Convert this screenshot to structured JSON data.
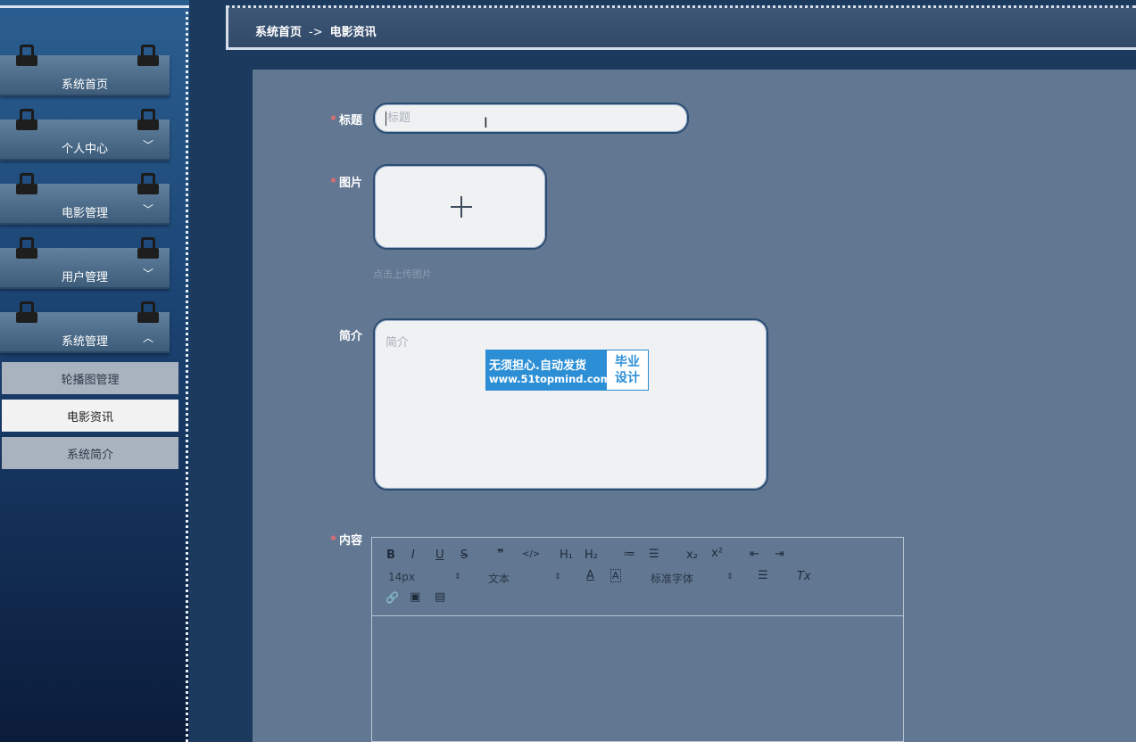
{
  "sidebar": {
    "items": [
      {
        "label": "系统首页",
        "chevron": ""
      },
      {
        "label": "个人中心",
        "chevron": "﹀"
      },
      {
        "label": "电影管理",
        "chevron": "﹀"
      },
      {
        "label": "用户管理",
        "chevron": "﹀"
      },
      {
        "label": "系统管理",
        "chevron": "︿"
      }
    ],
    "sub_items": [
      {
        "label": "轮播图管理"
      },
      {
        "label": "电影资讯"
      },
      {
        "label": "系统简介"
      }
    ]
  },
  "breadcrumb": {
    "home": "系统首页",
    "separator": "->",
    "current": "电影资讯"
  },
  "form": {
    "title_label": "标题",
    "title_placeholder": "标题",
    "image_label": "图片",
    "upload_hint": "点击上传图片",
    "desc_label": "简介",
    "desc_placeholder": "简介",
    "content_label": "内容",
    "required_mark": "*"
  },
  "watermark": {
    "line1": "无须担心.自动发货",
    "line2": "www.51topmind.com",
    "right1": "毕业",
    "right2": "设计"
  },
  "editor": {
    "bold": "B",
    "italic": "I",
    "underline": "U",
    "strike": "S",
    "quote": "❞",
    "code": "</>",
    "h1": "H₁",
    "h2": "H₂",
    "ordered_list": "≔",
    "bullet_list": "☰",
    "subscript": "x₂",
    "superscript": "x²",
    "outdent": "⇤",
    "indent": "⇥",
    "font_size": "14px",
    "heading": "文本",
    "font_family": "标准字体",
    "color": "A",
    "background": "A",
    "align": "☰",
    "clean": "Tx",
    "select_arrow": "⇕",
    "link": "🔗",
    "image": "▣",
    "video": "▤"
  },
  "colors": {
    "accent_required": "#f56c6c",
    "sidebar_top": "#2b5e90",
    "main_bg": "#627792"
  }
}
